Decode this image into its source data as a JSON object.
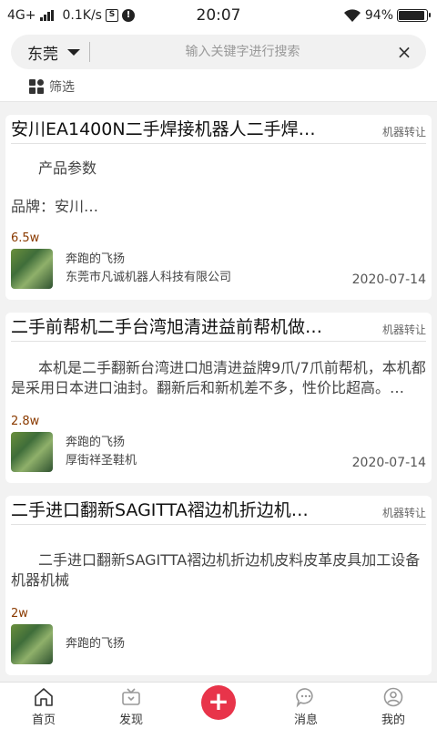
{
  "status": {
    "network": "4G+",
    "speed": "0.1K/s",
    "time": "20:07",
    "battery": "94%",
    "battery_level": 0.94
  },
  "search": {
    "city": "东莞",
    "placeholder": "输入关键字进行搜索",
    "filter_label": "筛选"
  },
  "listings": [
    {
      "title": "安川EA1400N二手焊接机器人二手焊…",
      "tag": "机器转让",
      "body_lines": [
        "产品参数",
        "品牌：安川…"
      ],
      "views": "6.5w",
      "user": "奔跑的飞扬",
      "company": "东莞市凡诚机器人科技有限公司",
      "date": "2020-07-14"
    },
    {
      "title": "二手前帮机二手台湾旭清进益前帮机做…",
      "tag": "机器转让",
      "body": "本机是二手翻新台湾进口旭清进益牌9爪/7爪前帮机，本机都是采用日本进口油封。翻新后和新机差不多，性价比超高。…",
      "views": "2.8w",
      "user": "奔跑的飞扬",
      "company": "厚街祥圣鞋机",
      "date": "2020-07-14"
    },
    {
      "title": "二手进口翻新SAGITTA褶边机折边机…",
      "tag": "机器转让",
      "body": "二手进口翻新SAGITTA褶边机折边机皮料皮革皮具加工设备机器机械",
      "views": "2w",
      "user": "奔跑的飞扬"
    }
  ],
  "tabs": [
    {
      "label": "首页",
      "icon": "home-icon"
    },
    {
      "label": "发现",
      "icon": "tv-icon"
    },
    {
      "label": "",
      "icon": "plus-icon"
    },
    {
      "label": "消息",
      "icon": "chat-icon"
    },
    {
      "label": "我的",
      "icon": "user-icon"
    }
  ],
  "colors": {
    "accent": "#e8344a",
    "price": "#8a3a00"
  }
}
